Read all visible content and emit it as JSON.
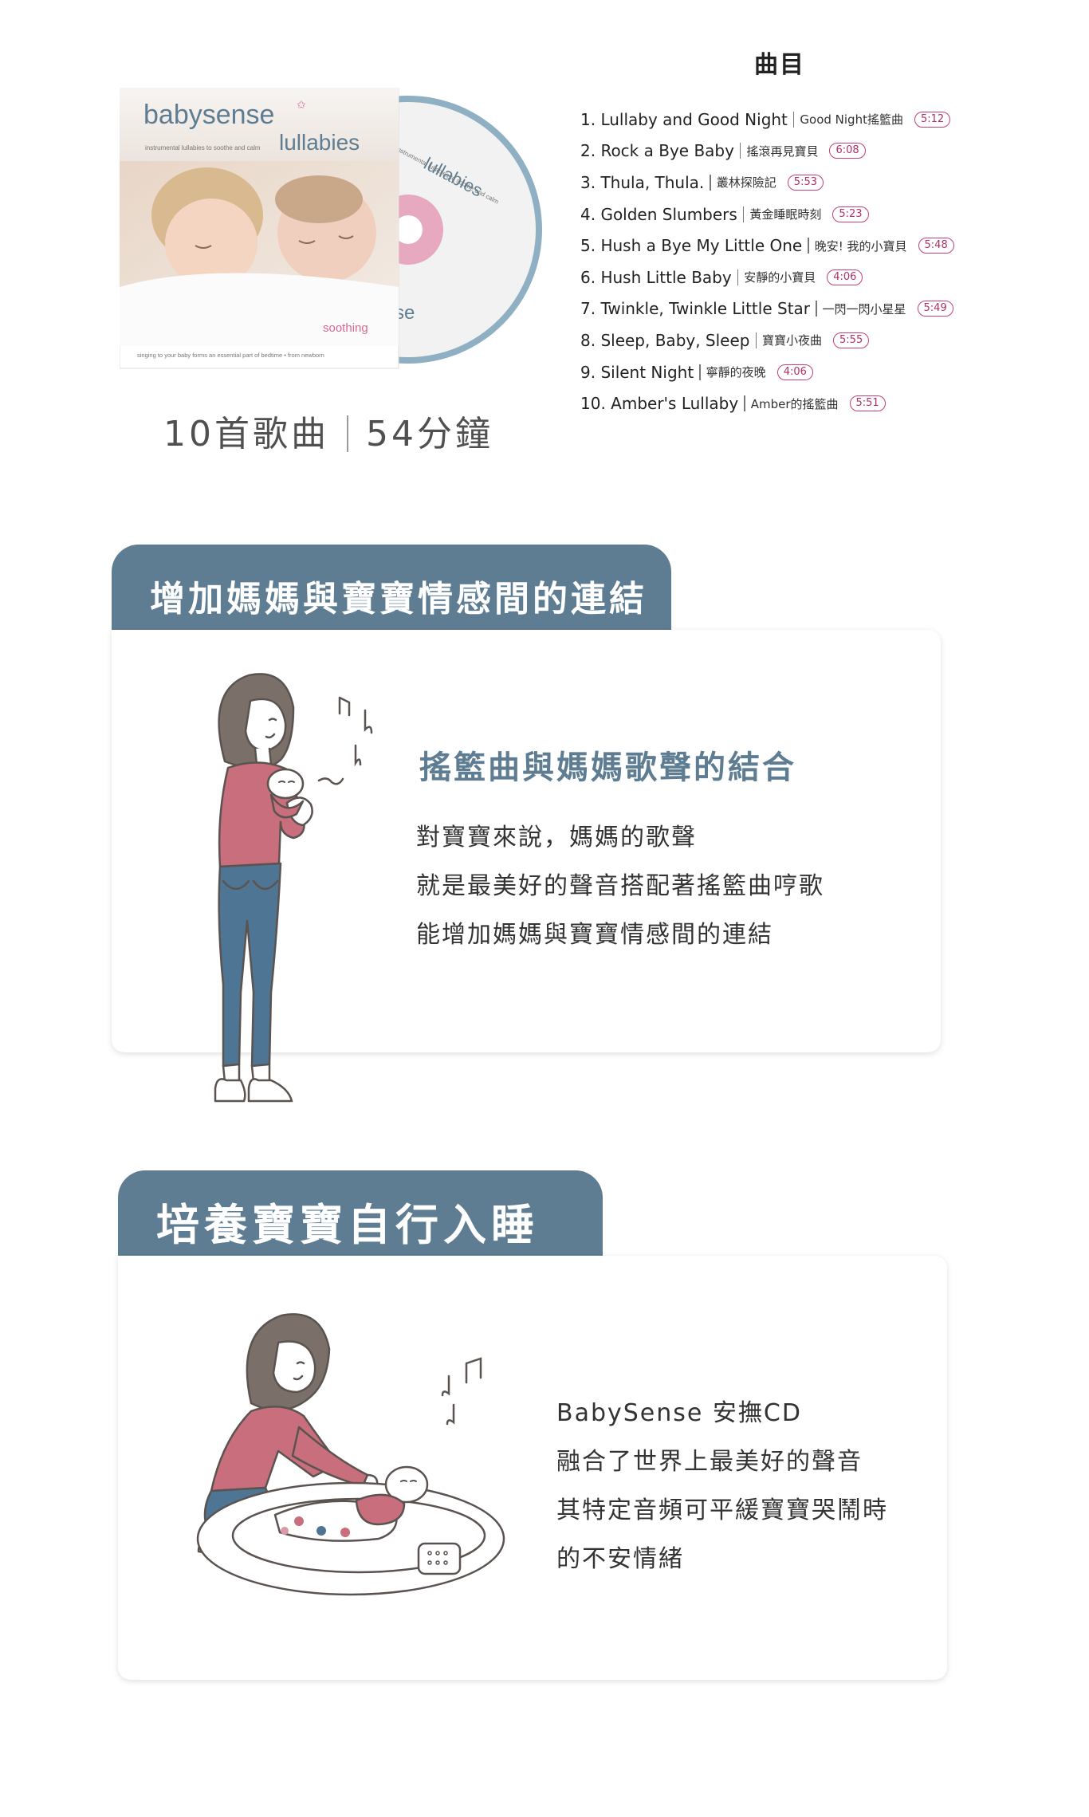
{
  "album": {
    "brand": "babysense",
    "product": "lullabies",
    "tagline": "instrumental lullabies to soothe and calm",
    "badge": "soothing",
    "footer_line": "singing to your baby forms an essential part of bedtime • from newborn",
    "disc_label": "lullabies",
    "disc_sub": "instrumental lullabies to soothe and calm",
    "disc_brand": "se",
    "track_count": "10首歌曲",
    "total_time": "54分鐘"
  },
  "tracklist": {
    "heading": "曲目",
    "tracks": [
      {
        "title": "1. Lullaby and Good Night",
        "subtitle": "Good Night搖籃曲",
        "duration": "5:12"
      },
      {
        "title": "2. Rock a Bye Baby",
        "subtitle": "搖滾再見寶貝",
        "duration": "6:08"
      },
      {
        "title": "3. Thula, Thula.",
        "subtitle": "叢林探險記",
        "duration": "5:53"
      },
      {
        "title": "4. Golden Slumbers",
        "subtitle": "黃金睡眠時刻",
        "duration": "5:23"
      },
      {
        "title": "5. Hush a Bye My Little One",
        "subtitle": "晚安! 我的小寶貝",
        "duration": "5:48"
      },
      {
        "title": "6. Hush Little Baby",
        "subtitle": "安靜的小寶貝",
        "duration": "4:06"
      },
      {
        "title": "7. Twinkle, Twinkle Little Star",
        "subtitle": "一閃一閃小星星",
        "duration": "5:49"
      },
      {
        "title": "8. Sleep, Baby, Sleep",
        "subtitle": "寶寶小夜曲",
        "duration": "5:55"
      },
      {
        "title": "9. Silent Night",
        "subtitle": "寧靜的夜晚",
        "duration": "4:06"
      },
      {
        "title": "10. Amber's Lullaby",
        "subtitle": "Amber的搖籃曲",
        "duration": "5:51"
      }
    ]
  },
  "section1": {
    "tab_title": "增加媽媽與寶寶情感間的連結",
    "heading": "搖籃曲與媽媽歌聲的結合",
    "lines": [
      "對寶寶來說，媽媽的歌聲",
      "就是最美好的聲音搭配著搖籃曲哼歌",
      "能增加媽媽與寶寶情感間的連結"
    ]
  },
  "section2": {
    "tab_title": "培養寶寶自行入睡",
    "lines": [
      "BabySense 安撫CD",
      "融合了世界上最美好的聲音",
      "其特定音頻可平緩寶寶哭鬧時",
      "的不安情緒"
    ]
  },
  "colors": {
    "accent": "#5e7d92",
    "pink": "#c2407a",
    "shirt": "#c96e7c",
    "jeans": "#4f7594",
    "hair": "#7b7069"
  }
}
